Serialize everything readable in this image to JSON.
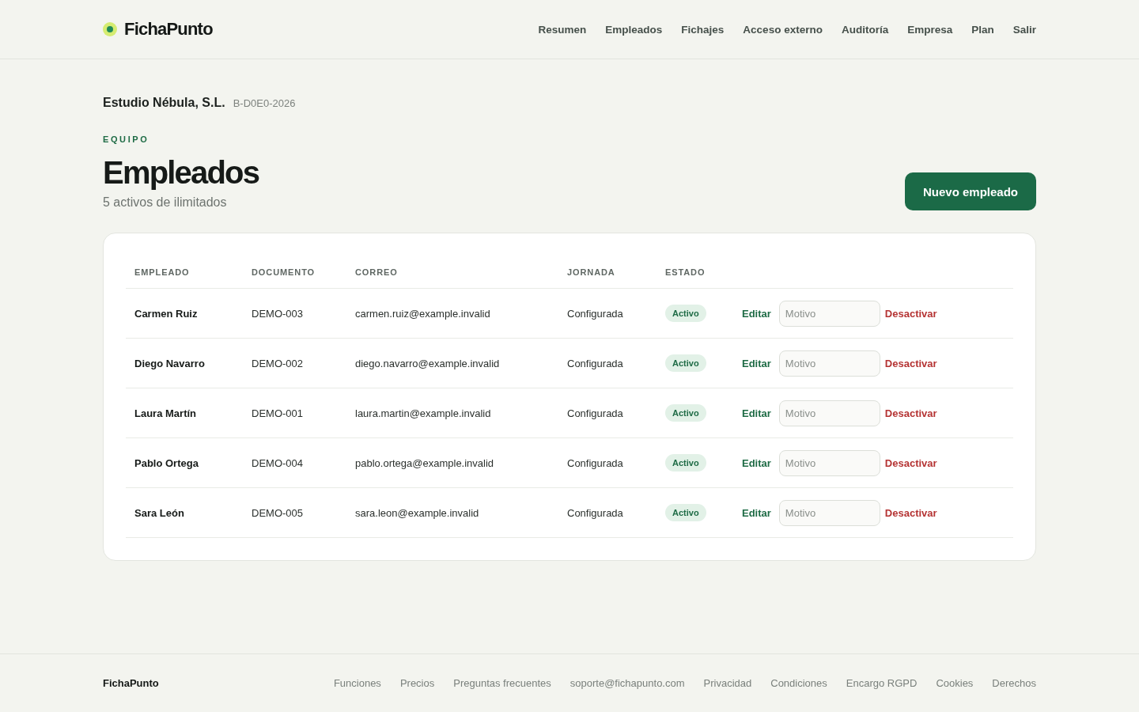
{
  "header": {
    "brand": "FichaPunto",
    "nav": [
      "Resumen",
      "Empleados",
      "Fichajes",
      "Acceso externo",
      "Auditoría",
      "Empresa",
      "Plan",
      "Salir"
    ]
  },
  "company": {
    "name": "Estudio Nébula, S.L.",
    "tax_id": "B-D0E0-2026"
  },
  "page": {
    "eyebrow": "EQUIPO",
    "title": "Empleados",
    "subtitle": "5 activos de ilimitados",
    "primary_button": "Nuevo empleado"
  },
  "table": {
    "columns": [
      "EMPLEADO",
      "DOCUMENTO",
      "CORREO",
      "JORNADA",
      "ESTADO"
    ],
    "rows": [
      {
        "name": "Carmen Ruiz",
        "document": "DEMO-003",
        "email": "carmen.ruiz@example.invalid",
        "schedule": "Configurada",
        "status": "Activo",
        "edit": "Editar",
        "reason_placeholder": "Motivo",
        "deactivate": "Desactivar"
      },
      {
        "name": "Diego Navarro",
        "document": "DEMO-002",
        "email": "diego.navarro@example.invalid",
        "schedule": "Configurada",
        "status": "Activo",
        "edit": "Editar",
        "reason_placeholder": "Motivo",
        "deactivate": "Desactivar"
      },
      {
        "name": "Laura Martín",
        "document": "DEMO-001",
        "email": "laura.martin@example.invalid",
        "schedule": "Configurada",
        "status": "Activo",
        "edit": "Editar",
        "reason_placeholder": "Motivo",
        "deactivate": "Desactivar"
      },
      {
        "name": "Pablo Ortega",
        "document": "DEMO-004",
        "email": "pablo.ortega@example.invalid",
        "schedule": "Configurada",
        "status": "Activo",
        "edit": "Editar",
        "reason_placeholder": "Motivo",
        "deactivate": "Desactivar"
      },
      {
        "name": "Sara León",
        "document": "DEMO-005",
        "email": "sara.leon@example.invalid",
        "schedule": "Configurada",
        "status": "Activo",
        "edit": "Editar",
        "reason_placeholder": "Motivo",
        "deactivate": "Desactivar"
      }
    ]
  },
  "footer": {
    "brand": "FichaPunto",
    "links": [
      "Funciones",
      "Precios",
      "Preguntas frecuentes",
      "soporte@fichapunto.com",
      "Privacidad",
      "Condiciones",
      "Encargo RGPD",
      "Cookies",
      "Derechos"
    ]
  }
}
